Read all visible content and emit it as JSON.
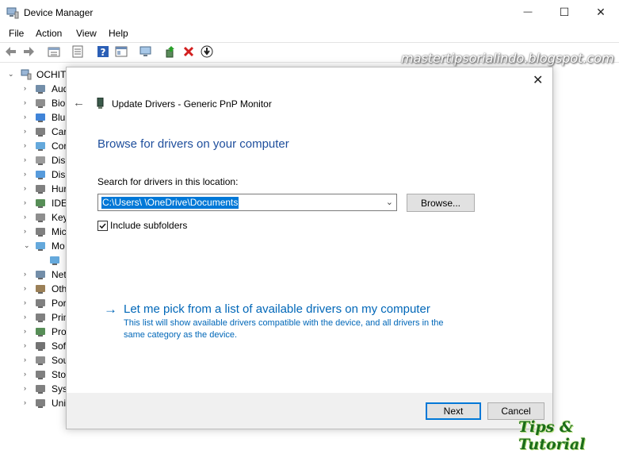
{
  "window": {
    "title": "Device Manager",
    "minimize_glyph": "—",
    "maximize_glyph": "☐",
    "close_glyph": "✕"
  },
  "menu": [
    "File",
    "Action",
    "View",
    "Help"
  ],
  "toolbar_icons": [
    "back-icon",
    "forward-icon",
    "properties-icon",
    "view-icon",
    "help-icon",
    "console-icon",
    "monitor-scan-icon",
    "update-driver-icon",
    "uninstall-icon",
    "download-icon"
  ],
  "tree": {
    "root": "OCHIT",
    "items": [
      {
        "label": "Aud",
        "icon": "audio-icon",
        "arrow": "›"
      },
      {
        "label": "Bio",
        "icon": "biometric-icon",
        "arrow": "›"
      },
      {
        "label": "Blu",
        "icon": "bluetooth-icon",
        "arrow": "›"
      },
      {
        "label": "Car",
        "icon": "camera-icon",
        "arrow": "›"
      },
      {
        "label": "Cor",
        "icon": "computer-icon",
        "arrow": "›"
      },
      {
        "label": "Disl",
        "icon": "disk-icon",
        "arrow": "›"
      },
      {
        "label": "Disp",
        "icon": "display-icon",
        "arrow": "›"
      },
      {
        "label": "Hur",
        "icon": "hid-icon",
        "arrow": "›"
      },
      {
        "label": "IDE",
        "icon": "ide-icon",
        "arrow": "›"
      },
      {
        "label": "Key",
        "icon": "keyboard-icon",
        "arrow": "›"
      },
      {
        "label": "Mic",
        "icon": "mouse-icon",
        "arrow": "›"
      },
      {
        "label": "Mo",
        "icon": "monitor-icon",
        "arrow": "⌄"
      },
      {
        "label": "",
        "icon": "monitor-child-icon",
        "arrow": ""
      },
      {
        "label": "Net",
        "icon": "network-icon",
        "arrow": "›"
      },
      {
        "label": "Oth",
        "icon": "other-icon",
        "arrow": "›"
      },
      {
        "label": "Por",
        "icon": "port-icon",
        "arrow": "›"
      },
      {
        "label": "Prin",
        "icon": "printer-icon",
        "arrow": "›"
      },
      {
        "label": "Pro",
        "icon": "processor-icon",
        "arrow": "›"
      },
      {
        "label": "Soft",
        "icon": "software-icon",
        "arrow": "›"
      },
      {
        "label": "Sou",
        "icon": "sound-icon",
        "arrow": "›"
      },
      {
        "label": "Sto",
        "icon": "storage-icon",
        "arrow": "›"
      },
      {
        "label": "Syst",
        "icon": "system-icon",
        "arrow": "›"
      },
      {
        "label": "Uni",
        "icon": "usb-icon",
        "arrow": "›"
      }
    ]
  },
  "dialog": {
    "header_title": "Update Drivers - Generic PnP Monitor",
    "heading": "Browse for drivers on your computer",
    "search_label": "Search for drivers in this location:",
    "path_value": "C:\\Users\\        \\OneDrive\\Documents",
    "browse_label": "Browse...",
    "include_subfolders_label": "Include subfolders",
    "include_subfolders_checked": true,
    "pick_link": "Let me pick from a list of available drivers on my computer",
    "pick_desc_line1": "This list will show available drivers compatible with the device, and all drivers in the",
    "pick_desc_line2": "same category as the device.",
    "next_label": "Next",
    "cancel_label": "Cancel"
  },
  "watermark": "mastertipsorialindo.blogspot.com",
  "logo": "Tips & Tutorial",
  "colors": {
    "accent": "#0078d7",
    "heading_blue": "#1e4e9c",
    "link_blue": "#0067b8"
  }
}
